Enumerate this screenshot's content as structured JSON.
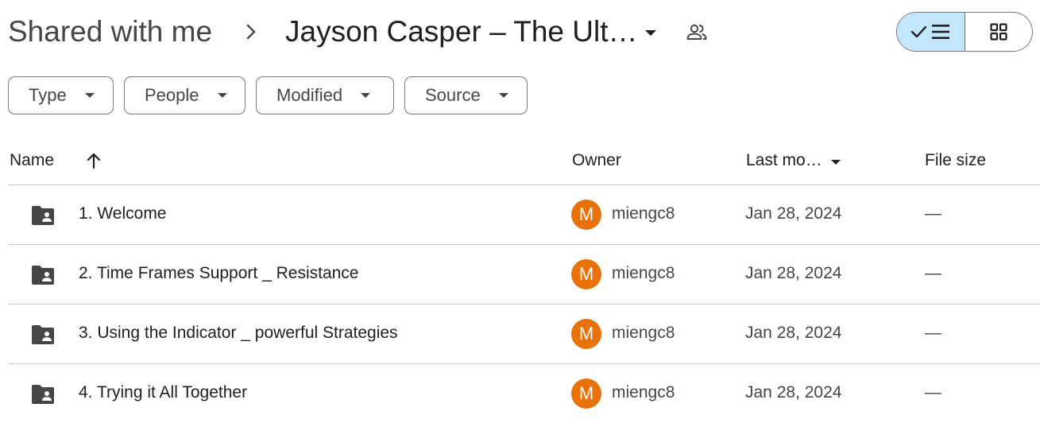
{
  "breadcrumb": {
    "root": "Shared with me",
    "current": "Jayson Casper – The Ult…"
  },
  "filters": {
    "type": "Type",
    "people": "People",
    "modified": "Modified",
    "source": "Source"
  },
  "table": {
    "headers": {
      "name": "Name",
      "owner": "Owner",
      "last_modified": "Last mo…",
      "file_size": "File size"
    },
    "rows": [
      {
        "name": "1. Welcome",
        "owner_initial": "M",
        "owner": "miengc8",
        "modified": "Jan 28, 2024",
        "size": "—"
      },
      {
        "name": "2. Time Frames Support _ Resistance",
        "owner_initial": "M",
        "owner": "miengc8",
        "modified": "Jan 28, 2024",
        "size": "—"
      },
      {
        "name": "3. Using the Indicator _ powerful Strategies",
        "owner_initial": "M",
        "owner": "miengc8",
        "modified": "Jan 28, 2024",
        "size": "—"
      },
      {
        "name": "4. Trying it All Together",
        "owner_initial": "M",
        "owner": "miengc8",
        "modified": "Jan 28, 2024",
        "size": "—"
      }
    ]
  },
  "colors": {
    "accent_selected": "#c2e7ff",
    "avatar_bg": "#e8710a",
    "border": "#747775",
    "divider": "#c7c7c7"
  },
  "icons": {
    "breadcrumb_separator": "chevron-right-icon",
    "folder_menu": "arrow-drop-down-icon",
    "shared": "people-outline-icon",
    "list_view": "checkmark-list-icon",
    "grid_view": "grid-icon",
    "sort": "arrow-up-icon",
    "row_type": "shared-folder-icon"
  }
}
